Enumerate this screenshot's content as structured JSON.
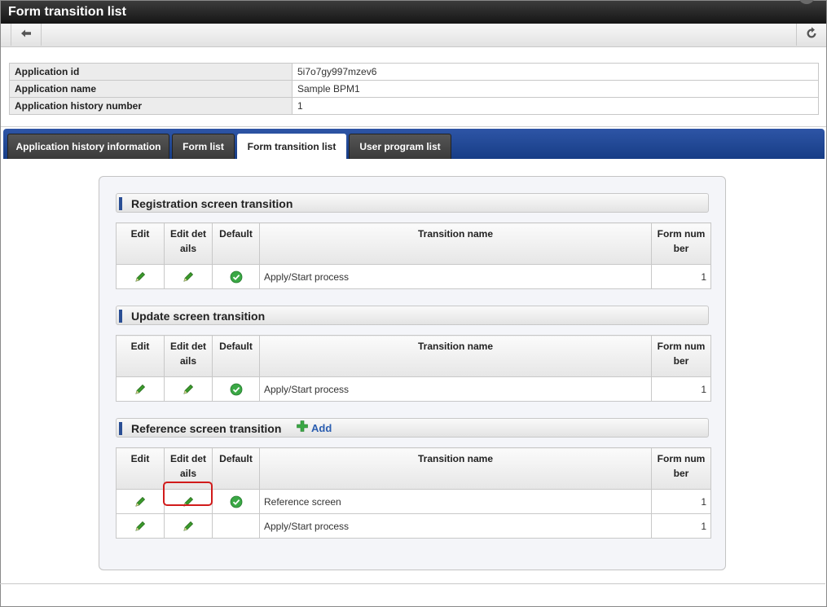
{
  "window": {
    "title": "Form transition list"
  },
  "toolbar": {
    "back_icon": "arrow-left-icon",
    "refresh_icon": "refresh-icon"
  },
  "info": [
    {
      "label": "Application id",
      "value": "5i7o7gy997mzev6"
    },
    {
      "label": "Application name",
      "value": "Sample BPM1"
    },
    {
      "label": "Application history number",
      "value": "1"
    }
  ],
  "tabs": [
    {
      "label": "Application history information",
      "active": false
    },
    {
      "label": "Form list",
      "active": false
    },
    {
      "label": "Form transition list",
      "active": true
    },
    {
      "label": "User program list",
      "active": false
    }
  ],
  "columns": {
    "edit": "Edit",
    "edit_details": "Edit det ails",
    "default": "Default",
    "transition_name": "Transition name",
    "form_number": "Form num ber"
  },
  "sections": [
    {
      "title": "Registration screen transition",
      "rows": [
        {
          "default": true,
          "name": "Apply/Start process",
          "form_number": "1"
        }
      ]
    },
    {
      "title": "Update screen transition",
      "rows": [
        {
          "default": true,
          "name": "Apply/Start process",
          "form_number": "1"
        }
      ]
    },
    {
      "title": "Reference screen transition",
      "add_label": "Add",
      "rows": [
        {
          "default": true,
          "name": "Reference screen",
          "form_number": "1"
        },
        {
          "default": false,
          "name": "Apply/Start process",
          "form_number": "1"
        }
      ]
    }
  ],
  "colors": {
    "tab_bar": "#1f4a98",
    "section_marker": "#2a4e94",
    "add_link": "#2a5db0",
    "highlight": "#d11b1b",
    "pencil": "#3b9a2b",
    "check": "#3aa845"
  }
}
